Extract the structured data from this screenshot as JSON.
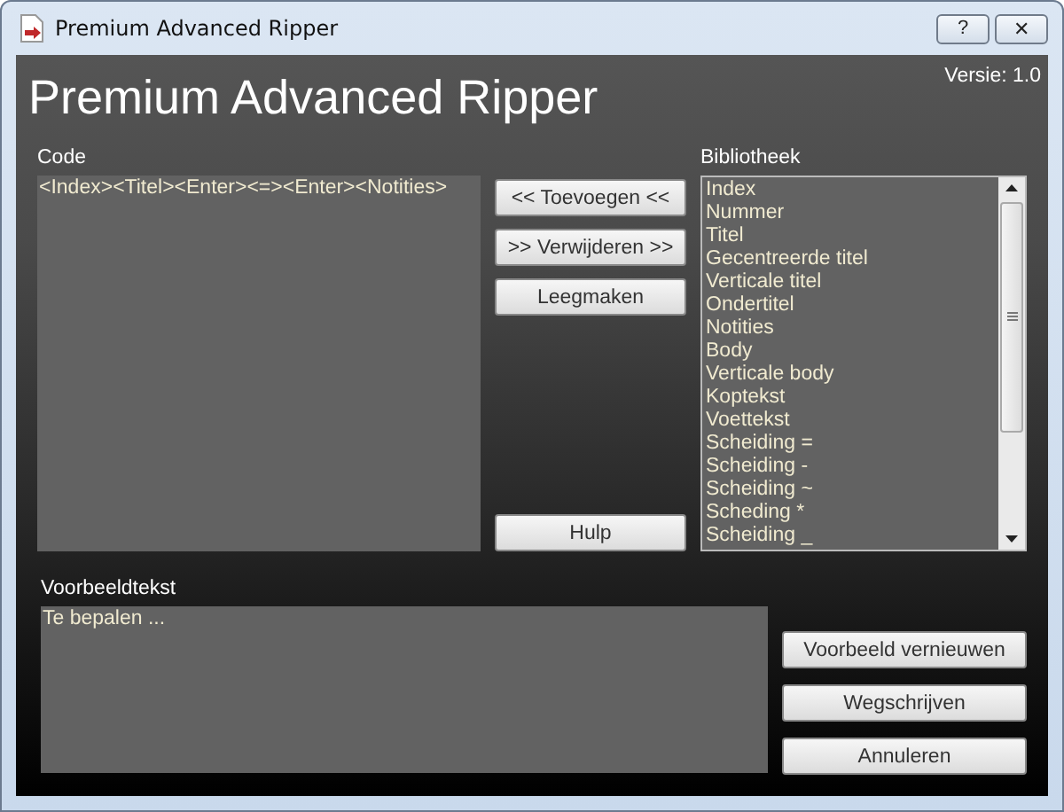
{
  "window": {
    "title": "Premium Advanced Ripper"
  },
  "title_buttons": [
    "?",
    "✕"
  ],
  "version": "Versie: 1.0",
  "heading": "Premium Advanced Ripper",
  "code": {
    "label": "Code",
    "value": "<Index><Titel><Enter><=><Enter><Notities>"
  },
  "middle_buttons": [
    "<< Toevoegen <<",
    ">> Verwijderen >>",
    "Leegmaken",
    "Hulp"
  ],
  "library": {
    "label": "Bibliotheek",
    "items": [
      "Index",
      "Nummer",
      "Titel",
      "Gecentreerde titel",
      "Verticale titel",
      "Ondertitel",
      "Notities",
      "Body",
      "Verticale body",
      "Koptekst",
      "Voettekst",
      "Scheiding =",
      "Scheiding -",
      "Scheiding ~",
      "Scheding *",
      "Scheiding _"
    ]
  },
  "preview": {
    "label": "Voorbeeldtekst",
    "value": "Te bepalen ..."
  },
  "bottom_buttons": [
    "Voorbeeld vernieuwen",
    "Wegschrijven",
    "Annuleren"
  ]
}
